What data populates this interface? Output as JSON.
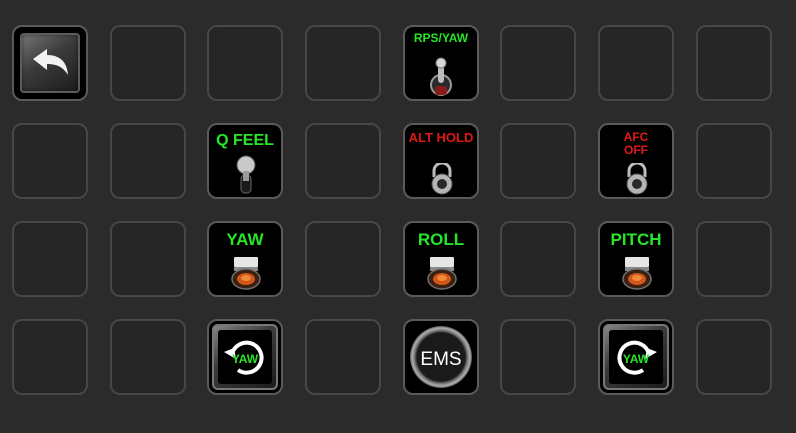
{
  "keys": {
    "back": {
      "icon": "back-arrow-icon"
    },
    "rps_yaw": {
      "label": "RPS/YAW",
      "icon": "toggle-switch-icon",
      "color": "#27e627"
    },
    "q_feel": {
      "label": "Q FEEL",
      "icon": "toggle-switch-icon",
      "color": "#27e627"
    },
    "alt_hold": {
      "label": "ALT HOLD",
      "icon": "guarded-switch-icon",
      "color": "#e01818"
    },
    "afc_off": {
      "label_line1": "AFC",
      "label_line2": "OFF",
      "icon": "guarded-switch-icon",
      "color": "#e01818"
    },
    "yaw": {
      "label": "YAW",
      "icon": "rocker-switch-icon",
      "color": "#27e627"
    },
    "roll": {
      "label": "ROLL",
      "icon": "rocker-switch-icon",
      "color": "#27e627"
    },
    "pitch": {
      "label": "PITCH",
      "icon": "rocker-switch-icon",
      "color": "#27e627"
    },
    "yaw_left": {
      "label": "YAW",
      "icon": "rotate-left-icon"
    },
    "ems": {
      "label": "EMS",
      "icon": "round-button-icon"
    },
    "yaw_right": {
      "label": "YAW",
      "icon": "rotate-right-icon"
    }
  }
}
